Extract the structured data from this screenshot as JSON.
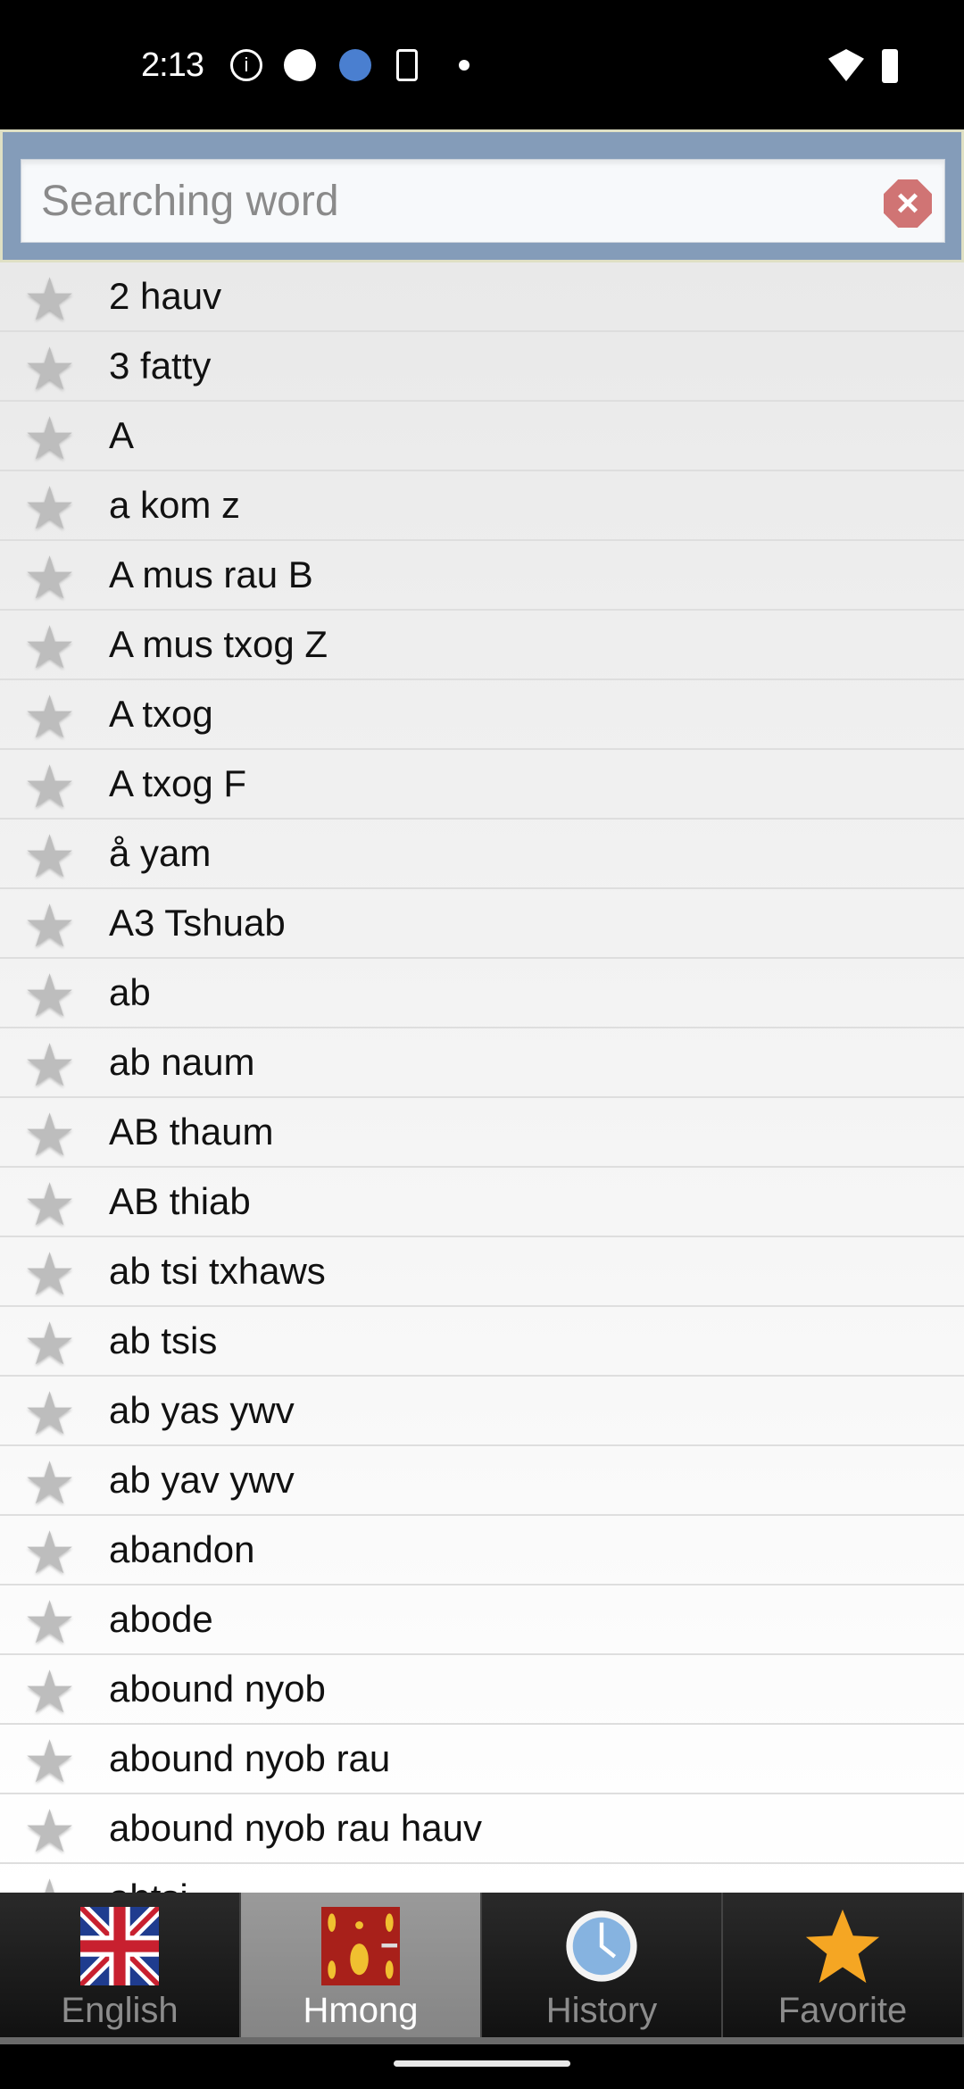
{
  "status_bar": {
    "time": "2:13"
  },
  "search": {
    "placeholder": "Searching word",
    "value": ""
  },
  "words": [
    "2 hauv",
    "3 fatty",
    "A",
    "a kom z",
    "A mus rau B",
    "A mus txog Z",
    "A txog",
    "A txog F",
    "å yam",
    "A3 Tshuab",
    "ab",
    "ab naum",
    "AB thaum",
    "AB thiab",
    "ab tsi txhaws",
    "ab tsis",
    "ab yas ywv",
    "ab yav ywv",
    "abandon",
    "abode",
    "abound nyob",
    "abound nyob rau",
    "abound nyob rau hauv",
    "abtsi"
  ],
  "tabs": [
    {
      "label": "English",
      "icon": "uk-flag-icon"
    },
    {
      "label": "Hmong",
      "icon": "hmong-flag-icon",
      "active": true
    },
    {
      "label": "History",
      "icon": "clock-icon"
    },
    {
      "label": "Favorite",
      "icon": "star-icon"
    }
  ],
  "colors": {
    "search_panel": "#849cb9",
    "active_tab": "#8f8f8f",
    "favorite_star": "#f5a623"
  }
}
